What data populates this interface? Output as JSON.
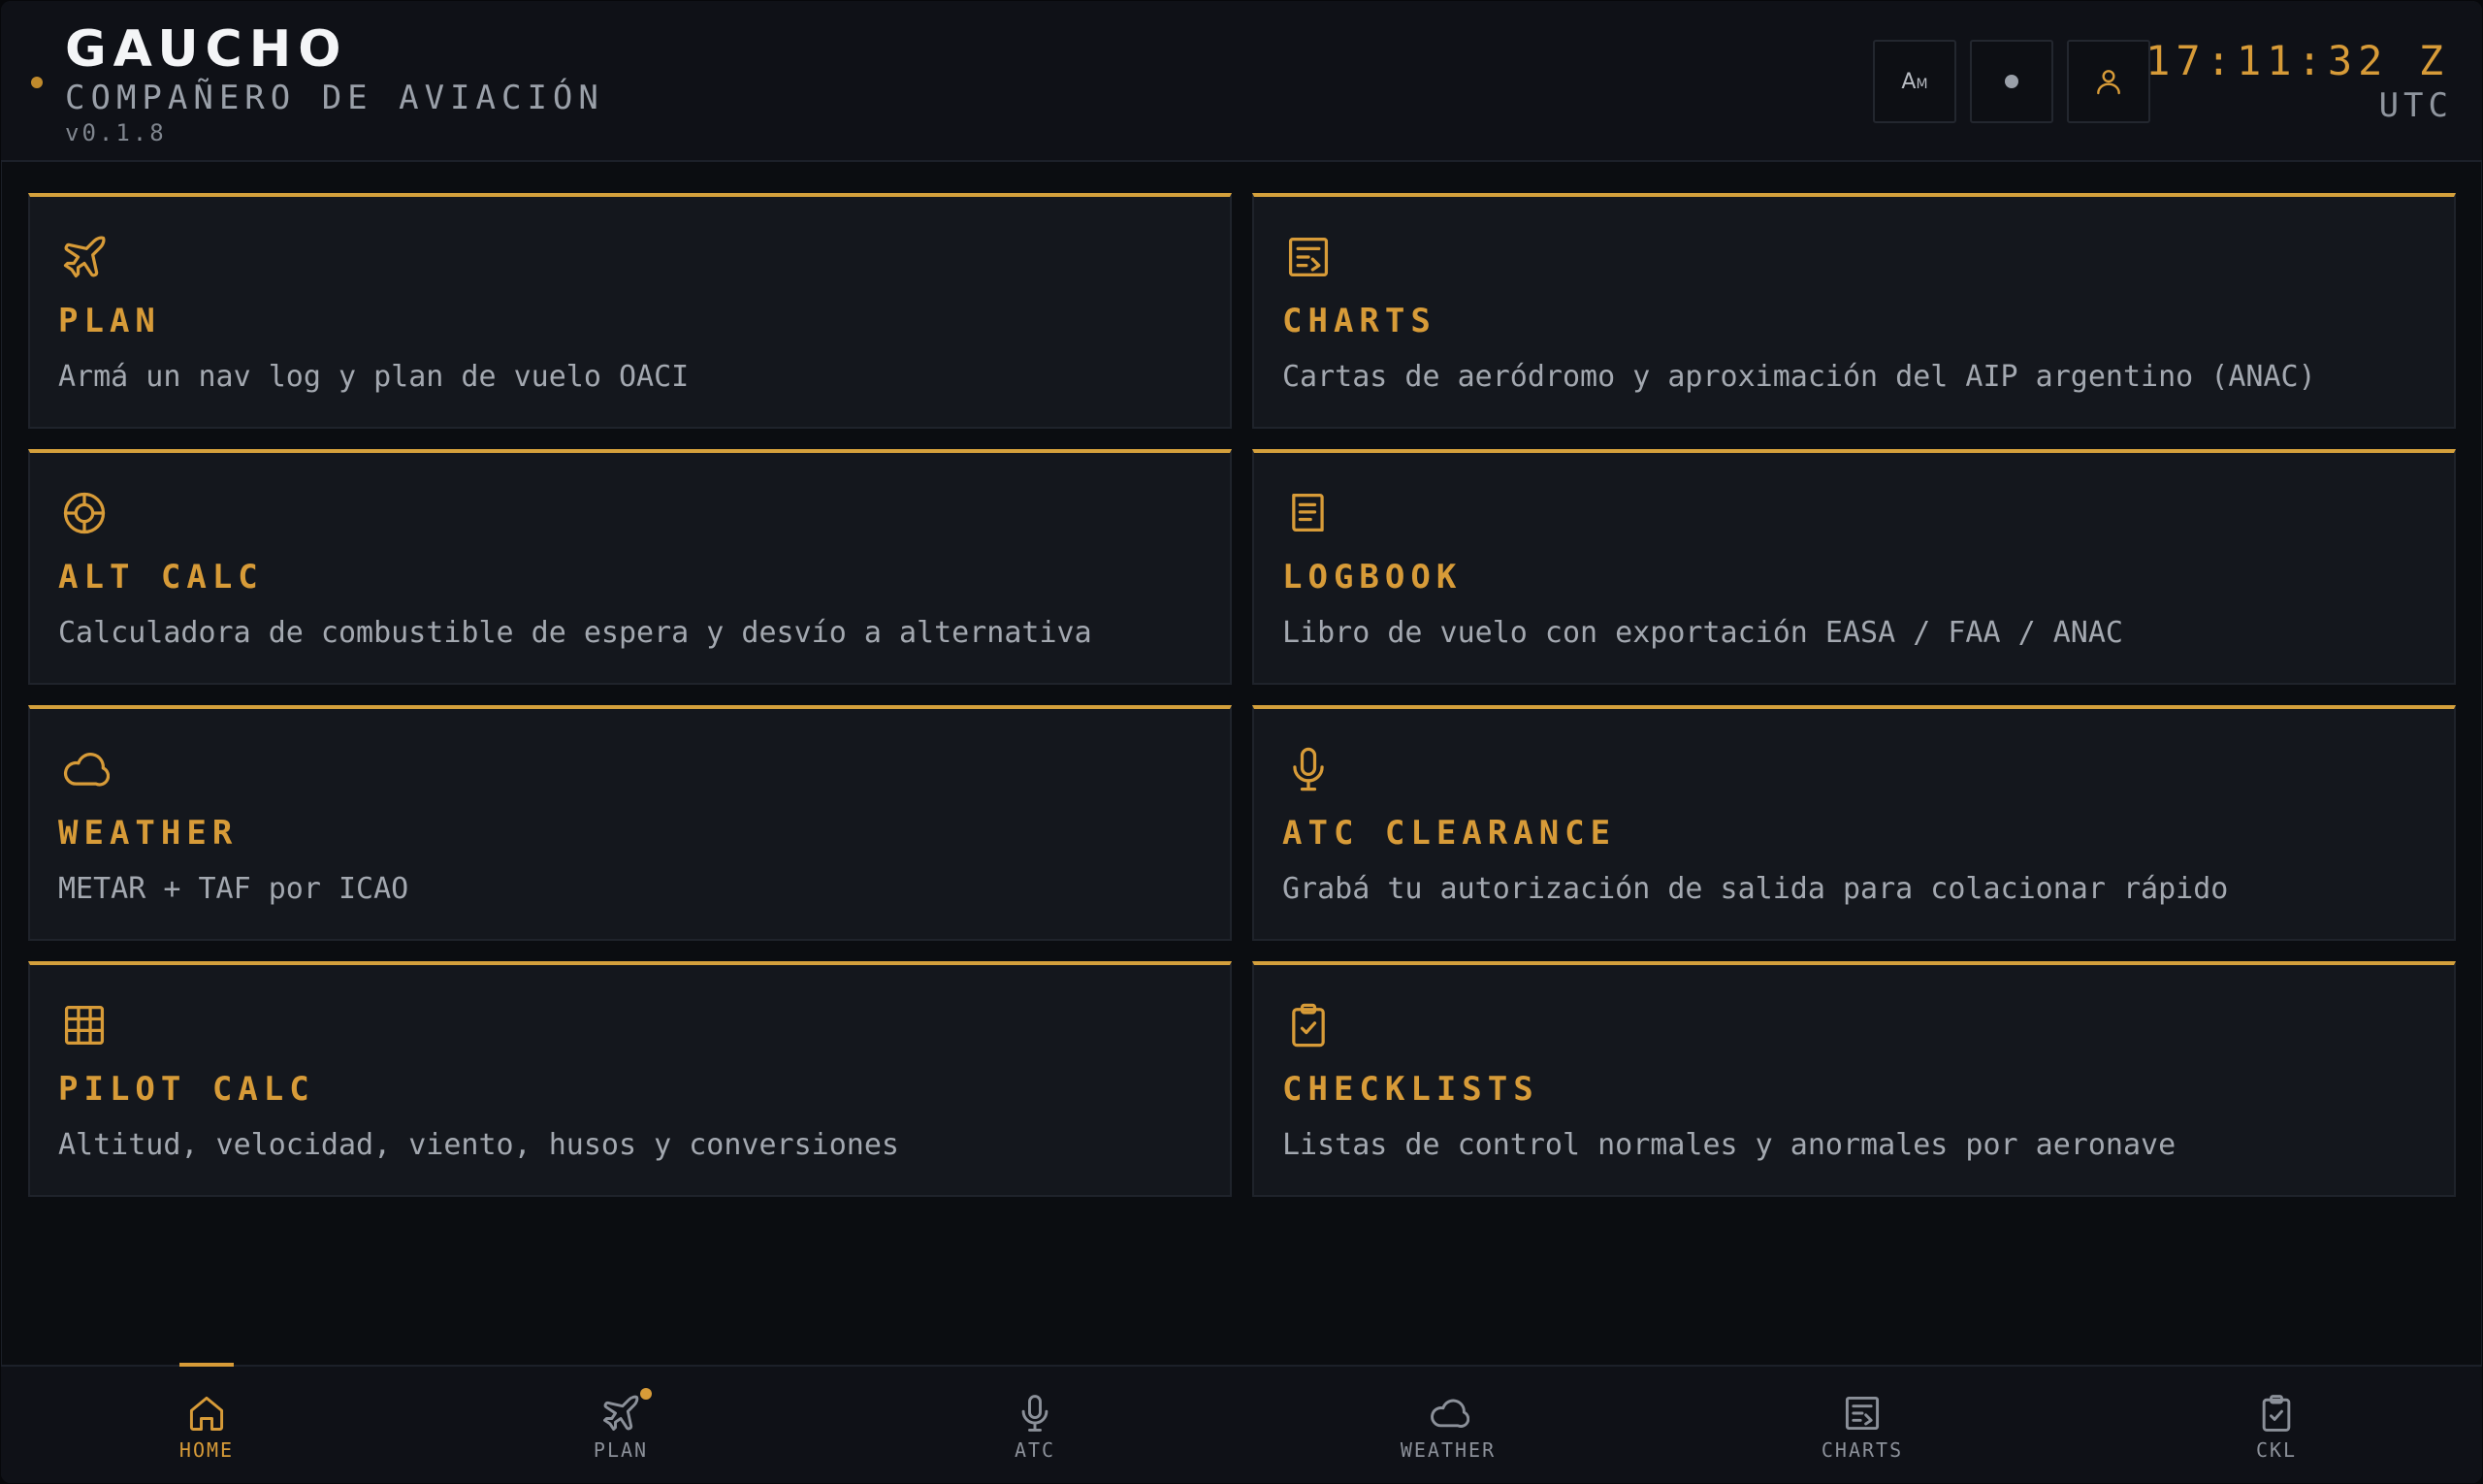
{
  "header": {
    "title": "GAUCHO",
    "subtitle": "COMPAÑERO DE AVIACIÓN",
    "version": "v0.1.8",
    "font_toggle_label_big": "A",
    "font_toggle_label_small": "M",
    "clock": "17:11:32 Z",
    "timezone": "UTC"
  },
  "cards": [
    {
      "title": "PLAN",
      "desc": "Armá un nav log y plan de vuelo OACI",
      "icon": "plane-icon"
    },
    {
      "title": "CHARTS",
      "desc": "Cartas de aeródromo y aproximación del AIP argentino (ANAC)",
      "icon": "chart-icon"
    },
    {
      "title": "ALT CALC",
      "desc": "Calculadora de combustible de espera y desvío a alternativa",
      "icon": "target-icon"
    },
    {
      "title": "LOGBOOK",
      "desc": "Libro de vuelo con exportación EASA / FAA / ANAC",
      "icon": "book-icon"
    },
    {
      "title": "WEATHER",
      "desc": "METAR + TAF por ICAO",
      "icon": "cloud-icon"
    },
    {
      "title": "ATC CLEARANCE",
      "desc": "Grabá tu autorización de salida para colacionar rápido",
      "icon": "microphone-icon"
    },
    {
      "title": "PILOT CALC",
      "desc": "Altitud, velocidad, viento, husos y conversiones",
      "icon": "grid-calculator-icon"
    },
    {
      "title": "CHECKLISTS",
      "desc": "Listas de control normales y anormales por aeronave",
      "icon": "clipboard-check-icon"
    }
  ],
  "nav": [
    {
      "label": "HOME",
      "icon": "home-icon",
      "active": true
    },
    {
      "label": "PLAN",
      "icon": "plane-icon",
      "badge": true
    },
    {
      "label": "ATC",
      "icon": "microphone-icon"
    },
    {
      "label": "WEATHER",
      "icon": "cloud-icon"
    },
    {
      "label": "CHARTS",
      "icon": "chart-icon"
    },
    {
      "label": "CKL",
      "icon": "clipboard-check-icon"
    }
  ],
  "colors": {
    "accent": "#d79b38",
    "card_bg": "#14171d",
    "header_bg": "#0f1117",
    "text_muted": "#a3a8b0"
  }
}
